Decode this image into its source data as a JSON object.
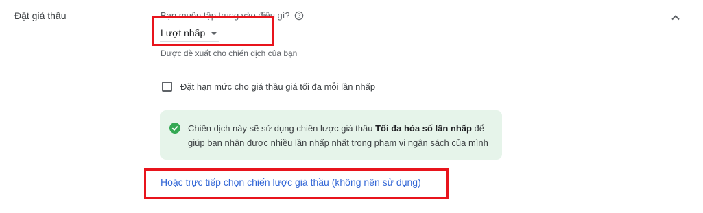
{
  "section": {
    "title": "Đặt giá thầu"
  },
  "focus": {
    "question": "Bạn muốn tập trung vào điều gì?",
    "selected": "Lượt nhấp",
    "hint": "Được đề xuất cho chiến dịch của bạn"
  },
  "max_cpc": {
    "label": "Đặt hạn mức cho giá thầu giá tối đa mỗi lần nhấp",
    "checked": false
  },
  "info": {
    "text_before": "Chiến dịch này sẽ sử dụng chiến lược giá thầu ",
    "strategy": "Tối đa hóa số lần nhấp",
    "text_after": " để giúp bạn nhận được nhiều lần nhấp nhất trong phạm vi ngân sách của mình"
  },
  "link": {
    "label": "Hoặc trực tiếp chọn chiến lược giá thầu (không nên sử dụng)"
  },
  "icons": {
    "help": "help-circle-icon",
    "collapse": "chevron-up-icon",
    "check": "check-circle-icon"
  },
  "colors": {
    "accent_link": "#3367d6",
    "success_green": "#34a853",
    "info_bg": "#e6f4ea",
    "highlight_red": "#e8141c"
  }
}
